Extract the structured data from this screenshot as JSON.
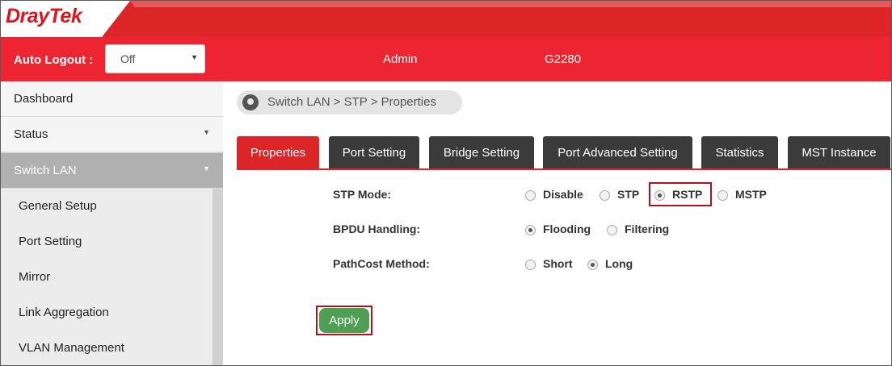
{
  "brand": {
    "logo_text": "DrayTek"
  },
  "header": {
    "auto_logout_label": "Auto Logout :",
    "auto_logout_value": "Off",
    "user": "Admin",
    "model": "G2280"
  },
  "sidebar": {
    "items": [
      {
        "label": "Dashboard",
        "has_chevron": false
      },
      {
        "label": "Status",
        "has_chevron": true
      },
      {
        "label": "Switch LAN",
        "has_chevron": true,
        "active": true
      }
    ],
    "subitems": [
      {
        "label": "General Setup"
      },
      {
        "label": "Port Setting"
      },
      {
        "label": "Mirror"
      },
      {
        "label": "Link Aggregation"
      },
      {
        "label": "VLAN Management"
      }
    ]
  },
  "breadcrumb": {
    "text": "Switch LAN > STP  > Properties"
  },
  "tabs": [
    {
      "label": "Properties",
      "active": true
    },
    {
      "label": "Port Setting"
    },
    {
      "label": "Bridge Setting"
    },
    {
      "label": "Port Advanced Setting"
    },
    {
      "label": "Statistics"
    },
    {
      "label": "MST Instance"
    }
  ],
  "form": {
    "stp_mode": {
      "label": "STP Mode:",
      "options": [
        "Disable",
        "STP",
        "RSTP",
        "MSTP"
      ],
      "selected": "RSTP"
    },
    "bpdu_handling": {
      "label": "BPDU Handling:",
      "options": [
        "Flooding",
        "Filtering"
      ],
      "selected": "Flooding"
    },
    "pathcost_method": {
      "label": "PathCost Method:",
      "options": [
        "Short",
        "Long"
      ],
      "selected": "Long"
    }
  },
  "apply_label": "Apply",
  "colors": {
    "brand_red": "#ed2431",
    "active_tab": "#dc2526",
    "tab_dark": "#3b3b3b",
    "apply_green": "#4e9f53",
    "highlight": "#b3121d"
  }
}
